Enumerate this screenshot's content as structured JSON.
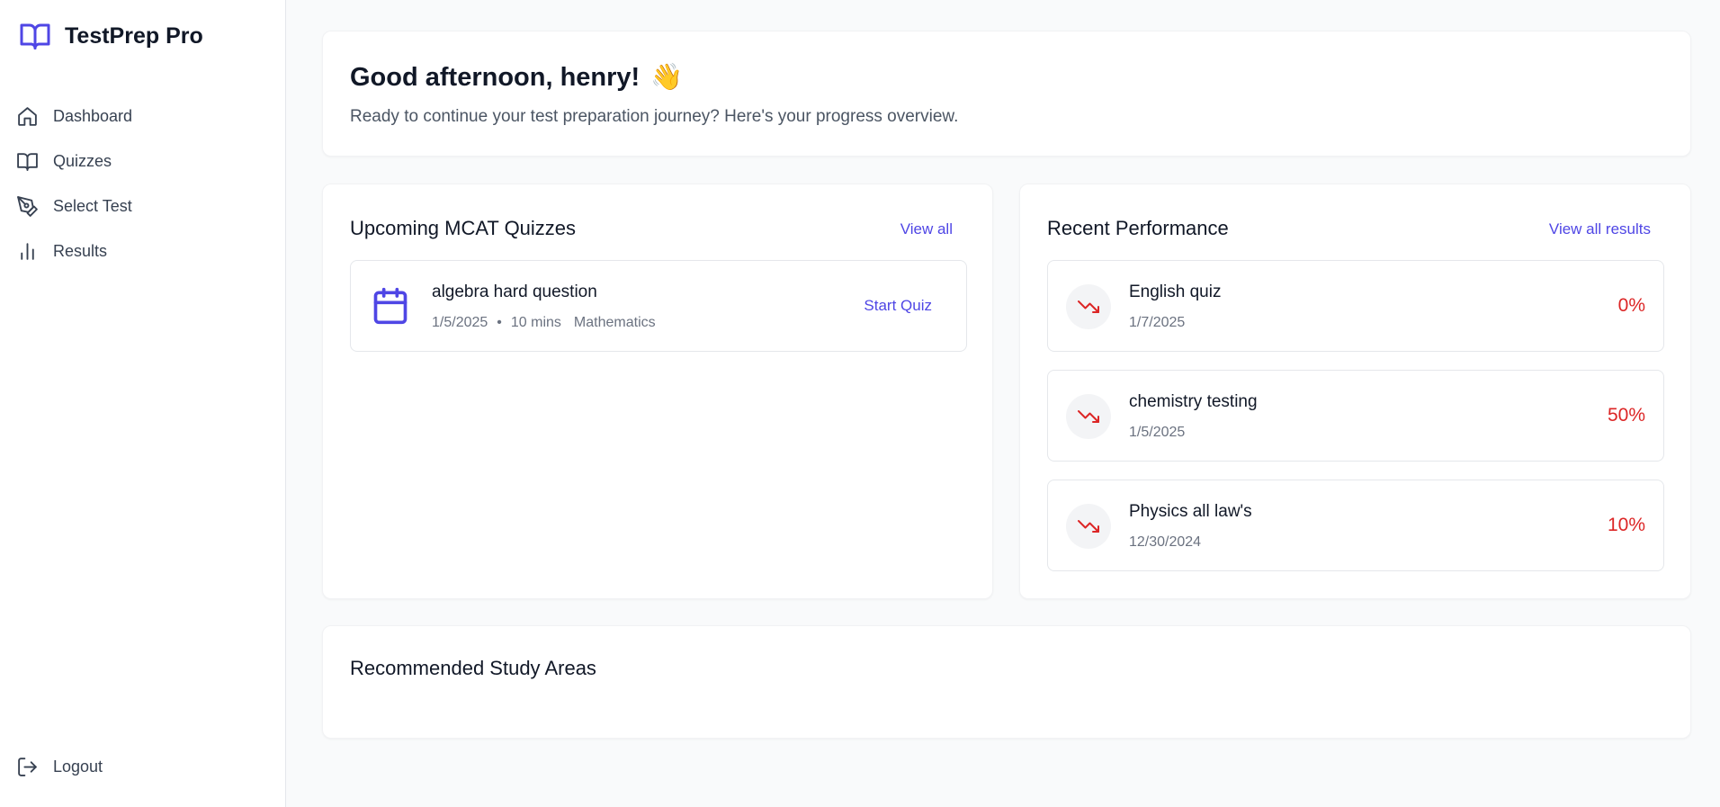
{
  "brand": {
    "title": "TestPrep Pro"
  },
  "nav": {
    "items": [
      {
        "label": "Dashboard",
        "icon": "home-icon"
      },
      {
        "label": "Quizzes",
        "icon": "book-icon"
      },
      {
        "label": "Select Test",
        "icon": "pen-tool-icon"
      },
      {
        "label": "Results",
        "icon": "bar-chart-icon"
      }
    ],
    "logout": "Logout"
  },
  "greeting": {
    "title": "Good afternoon, henry!",
    "emoji": "👋",
    "subtitle": "Ready to continue your test preparation journey? Here's your progress overview."
  },
  "quizzes": {
    "title": "Upcoming MCAT Quizzes",
    "view_all": "View all",
    "items": [
      {
        "title": "algebra hard question",
        "date": "1/5/2025",
        "separator": "•",
        "duration": "10 mins",
        "subject": "Mathematics",
        "action": "Start Quiz"
      }
    ]
  },
  "performance": {
    "title": "Recent Performance",
    "view_all": "View all results",
    "items": [
      {
        "title": "English quiz",
        "date": "1/7/2025",
        "score": "0%"
      },
      {
        "title": "chemistry testing",
        "date": "1/5/2025",
        "score": "50%"
      },
      {
        "title": "Physics all law's",
        "date": "12/30/2024",
        "score": "10%"
      }
    ]
  },
  "recommended": {
    "title": "Recommended Study Areas"
  },
  "colors": {
    "accent": "#4f46e5",
    "danger": "#dc2626",
    "text": "#111827",
    "muted": "#6b7280"
  }
}
